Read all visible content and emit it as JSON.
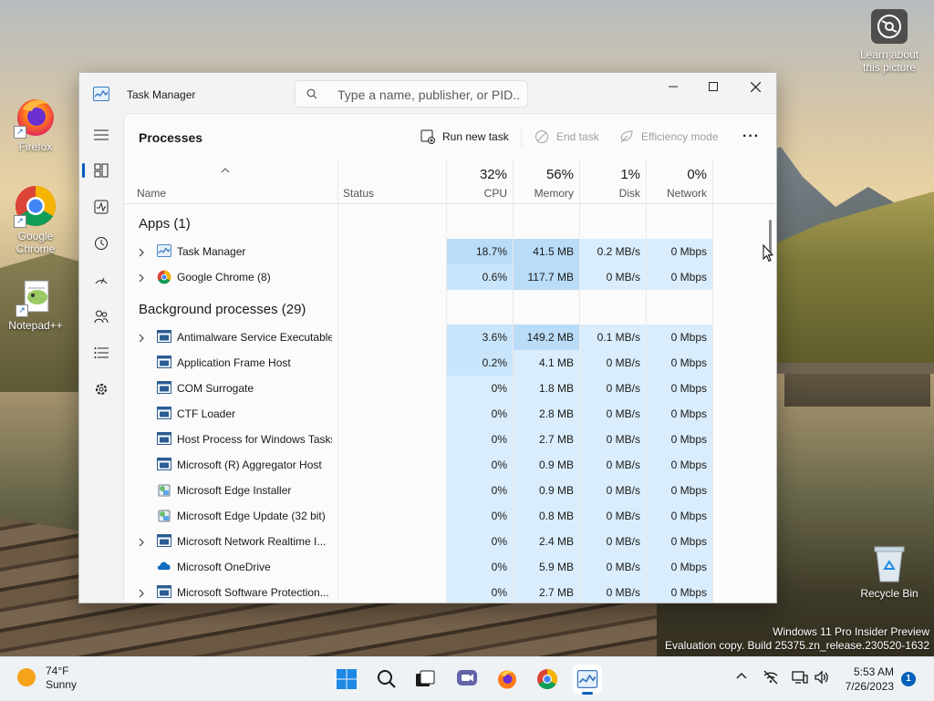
{
  "colors": {
    "accent": "#005fb8",
    "heat_high": "#b9dcf8",
    "heat_med": "#c9e5fb",
    "heat_low": "#daedfc",
    "heat_none": "#fbfbfb"
  },
  "desktop": {
    "icons": [
      {
        "label": "Firefox",
        "icon": "firefox-icon"
      },
      {
        "label": "Google Chrome",
        "icon": "chrome-icon"
      },
      {
        "label": "Notepad++",
        "icon": "notepad-plus-plus-icon"
      }
    ],
    "learn": {
      "label": "Learn about this picture",
      "icon": "camera-icon"
    },
    "recycle_bin": {
      "label": "Recycle Bin",
      "icon": "recycle-bin-icon"
    },
    "watermark": {
      "line1": "Windows 11 Pro Insider Preview",
      "line2": "Evaluation copy. Build 25375.zn_release.230520-1632"
    }
  },
  "window": {
    "title": "Task Manager",
    "search_placeholder": "Type a name, publisher, or PID..."
  },
  "nav": [
    {
      "name": "hamburger-menu",
      "icon": "hamburger-icon"
    },
    {
      "name": "processes",
      "icon": "processes-icon",
      "active": true
    },
    {
      "name": "performance",
      "icon": "performance-icon"
    },
    {
      "name": "app-history",
      "icon": "history-icon"
    },
    {
      "name": "startup-apps",
      "icon": "startup-icon"
    },
    {
      "name": "users",
      "icon": "users-icon"
    },
    {
      "name": "details",
      "icon": "details-icon"
    },
    {
      "name": "services",
      "icon": "services-icon"
    },
    {
      "name": "settings",
      "icon": "settings-icon"
    }
  ],
  "page": {
    "title": "Processes",
    "toolbar": {
      "run_new_task": "Run new task",
      "end_task": "End task",
      "efficiency_mode": "Efficiency mode",
      "more": "···"
    }
  },
  "columns": {
    "name": "Name",
    "status": "Status",
    "cpu": {
      "pct": "32%",
      "label": "CPU"
    },
    "memory": {
      "pct": "56%",
      "label": "Memory"
    },
    "disk": {
      "pct": "1%",
      "label": "Disk"
    },
    "network": {
      "pct": "0%",
      "label": "Network"
    }
  },
  "groups": {
    "apps": "Apps (1)",
    "background": "Background processes (29)"
  },
  "apps": [
    {
      "name": "Task Manager",
      "cpu": "18.7%",
      "memory": "41.5 MB",
      "disk": "0.2 MB/s",
      "network": "0 Mbps",
      "expandable": true,
      "icon": "task-manager-icon"
    },
    {
      "name": "Google Chrome (8)",
      "cpu": "0.6%",
      "memory": "117.7 MB",
      "disk": "0 MB/s",
      "network": "0 Mbps",
      "expandable": true,
      "icon": "chrome-icon"
    }
  ],
  "background": [
    {
      "name": "Antimalware Service Executable",
      "cpu": "3.6%",
      "memory": "149.2 MB",
      "disk": "0.1 MB/s",
      "network": "0 Mbps",
      "expandable": true,
      "icon": "service-icon"
    },
    {
      "name": "Application Frame Host",
      "cpu": "0.2%",
      "memory": "4.1 MB",
      "disk": "0 MB/s",
      "network": "0 Mbps",
      "expandable": false,
      "icon": "service-icon"
    },
    {
      "name": "COM Surrogate",
      "cpu": "0%",
      "memory": "1.8 MB",
      "disk": "0 MB/s",
      "network": "0 Mbps",
      "expandable": false,
      "icon": "service-icon"
    },
    {
      "name": "CTF Loader",
      "cpu": "0%",
      "memory": "2.8 MB",
      "disk": "0 MB/s",
      "network": "0 Mbps",
      "expandable": false,
      "icon": "service-icon"
    },
    {
      "name": "Host Process for Windows Tasks",
      "cpu": "0%",
      "memory": "2.7 MB",
      "disk": "0 MB/s",
      "network": "0 Mbps",
      "expandable": false,
      "icon": "service-icon"
    },
    {
      "name": "Microsoft (R) Aggregator Host",
      "cpu": "0%",
      "memory": "0.9 MB",
      "disk": "0 MB/s",
      "network": "0 Mbps",
      "expandable": false,
      "icon": "service-icon"
    },
    {
      "name": "Microsoft Edge Installer",
      "cpu": "0%",
      "memory": "0.9 MB",
      "disk": "0 MB/s",
      "network": "0 Mbps",
      "expandable": false,
      "icon": "installer-icon"
    },
    {
      "name": "Microsoft Edge Update (32 bit)",
      "cpu": "0%",
      "memory": "0.8 MB",
      "disk": "0 MB/s",
      "network": "0 Mbps",
      "expandable": false,
      "icon": "installer-icon"
    },
    {
      "name": "Microsoft Network Realtime I...",
      "cpu": "0%",
      "memory": "2.4 MB",
      "disk": "0 MB/s",
      "network": "0 Mbps",
      "expandable": true,
      "icon": "service-icon"
    },
    {
      "name": "Microsoft OneDrive",
      "cpu": "0%",
      "memory": "5.9 MB",
      "disk": "0 MB/s",
      "network": "0 Mbps",
      "expandable": false,
      "icon": "onedrive-icon"
    },
    {
      "name": "Microsoft Software Protection...",
      "cpu": "0%",
      "memory": "2.7 MB",
      "disk": "0 MB/s",
      "network": "0 Mbps",
      "expandable": true,
      "icon": "service-icon"
    }
  ],
  "taskbar": {
    "weather": {
      "temp": "74°F",
      "condition": "Sunny",
      "icon": "sun-icon"
    },
    "apps": [
      {
        "name": "start",
        "icon": "windows-logo-icon"
      },
      {
        "name": "search",
        "icon": "search-icon"
      },
      {
        "name": "task-view",
        "icon": "task-view-icon"
      },
      {
        "name": "chat",
        "icon": "chat-icon"
      },
      {
        "name": "firefox",
        "icon": "firefox-icon"
      },
      {
        "name": "chrome",
        "icon": "chrome-icon"
      },
      {
        "name": "task-manager",
        "icon": "task-manager-icon",
        "active": true
      }
    ],
    "tray": [
      "chevron-up-icon",
      "network-off-icon",
      "display-icon",
      "volume-icon"
    ],
    "time": "5:53 AM",
    "date": "7/26/2023",
    "notification_count": "1"
  }
}
